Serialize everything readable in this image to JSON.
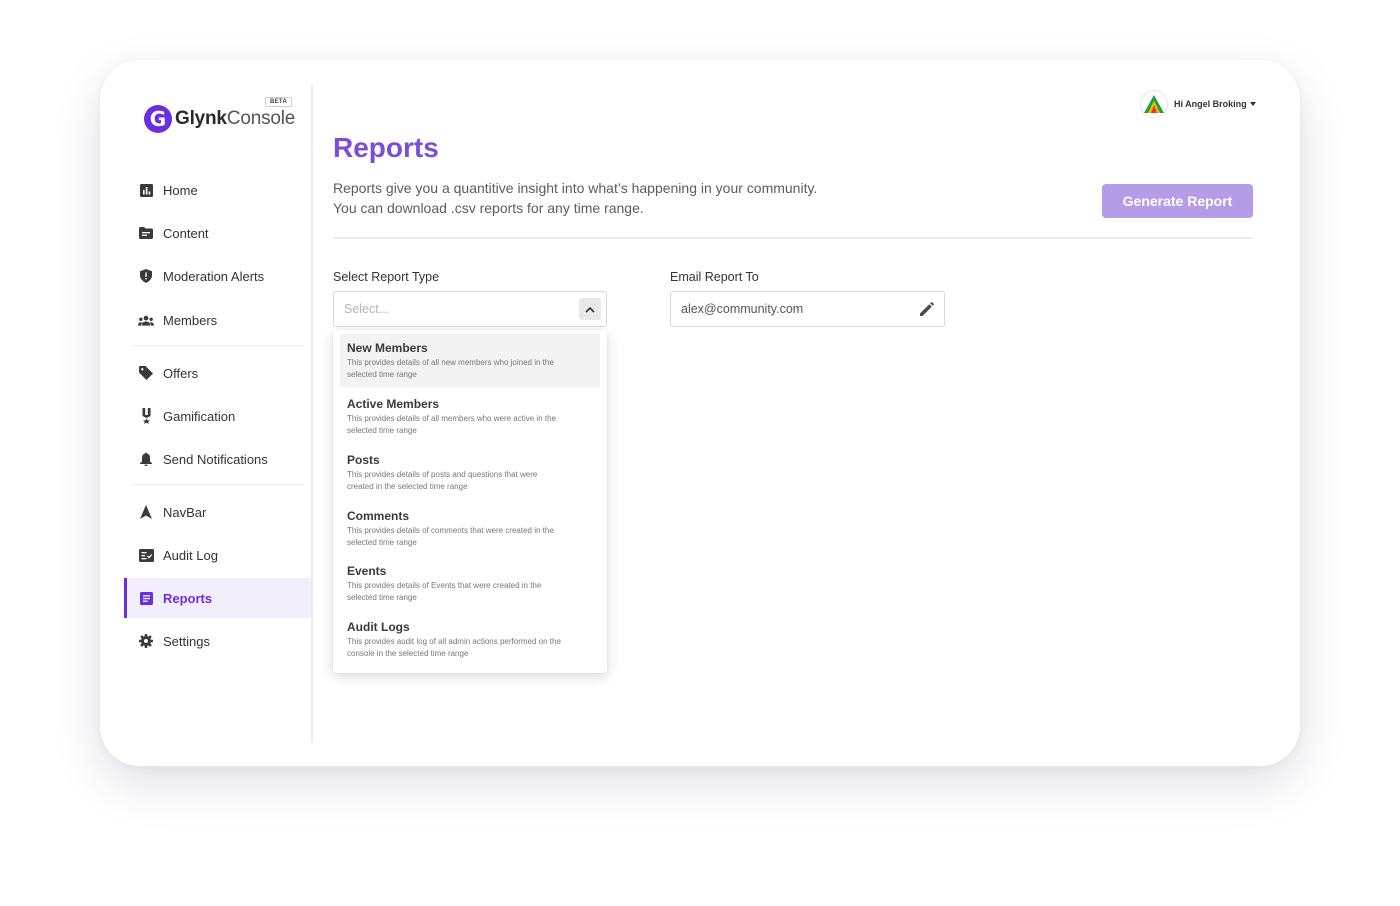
{
  "brand": {
    "name_bold": "Glynk",
    "name_light": "Console",
    "beta": "BETA",
    "mark": "G"
  },
  "user": {
    "greeting": "Hi Angel Broking"
  },
  "sidebar": {
    "items": [
      {
        "label": "Home",
        "icon": "bar-chart-icon"
      },
      {
        "label": "Content",
        "icon": "folder-icon"
      },
      {
        "label": "Moderation Alerts",
        "icon": "shield-alert-icon"
      },
      {
        "label": "Members",
        "icon": "people-icon"
      },
      {
        "label": "Offers",
        "icon": "tag-icon"
      },
      {
        "label": "Gamification",
        "icon": "medal-icon"
      },
      {
        "label": "Send Notifications",
        "icon": "bell-icon"
      },
      {
        "label": "NavBar",
        "icon": "navigation-arrow-icon"
      },
      {
        "label": "Audit Log",
        "icon": "checklist-icon"
      },
      {
        "label": "Reports",
        "icon": "document-icon",
        "active": true
      },
      {
        "label": "Settings",
        "icon": "gear-icon"
      }
    ]
  },
  "page": {
    "title": "Reports",
    "desc_line1": "Reports give you a quantitive insight into what’s happening in your community.",
    "desc_line2": "You can download .csv reports for any time range.",
    "generate_label": "Generate Report"
  },
  "form": {
    "report_type_label": "Select Report Type",
    "report_type_placeholder": "Select...",
    "email_label": "Email Report To",
    "email_value": "alex@community.com"
  },
  "options": [
    {
      "title": "New Members",
      "desc1": "This provides details of all new members who joined in the",
      "desc2": "selected time range"
    },
    {
      "title": "Active Members",
      "desc1": "This provides details of all members who were active in the",
      "desc2": "selected time range"
    },
    {
      "title": "Posts",
      "desc1": "This provides details of posts and questions that were",
      "desc2": "created in the selected time range"
    },
    {
      "title": "Comments",
      "desc1": "This provides details of comments that were created in the",
      "desc2": "selected time range"
    },
    {
      "title": "Events",
      "desc1": "This provides details of Events that were created in the",
      "desc2": "selected time range"
    },
    {
      "title": "Audit Logs",
      "desc1": "This provides audit log of all admin actions performed on the",
      "desc2": "console in the selected time range"
    }
  ],
  "colors": {
    "accent": "#6a2ee0",
    "title": "#7a4fd6",
    "button": "#b59ce8",
    "active_bg": "#f2eefc"
  }
}
